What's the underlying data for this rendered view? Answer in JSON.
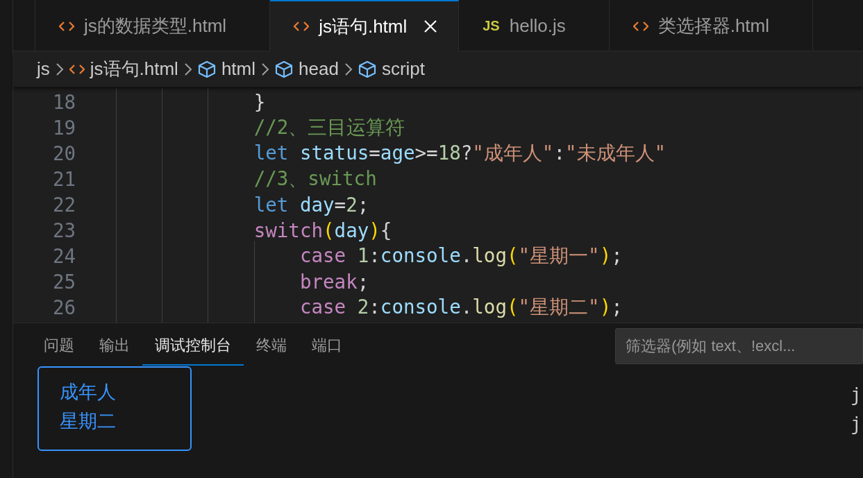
{
  "tabs": [
    {
      "label": "js的数据类型.html",
      "kind": "html",
      "selected": false
    },
    {
      "label": "js语句.html",
      "kind": "html",
      "selected": true
    },
    {
      "label": "hello.js",
      "kind": "js",
      "badge": "JS",
      "selected": false
    },
    {
      "label": "类选择器.html",
      "kind": "html",
      "selected": false
    }
  ],
  "breadcrumbs": [
    {
      "label": "js",
      "kind": "folder"
    },
    {
      "label": "js语句.html",
      "kind": "html"
    },
    {
      "label": "html",
      "kind": "element"
    },
    {
      "label": "head",
      "kind": "element"
    },
    {
      "label": "script",
      "kind": "element"
    }
  ],
  "editor": {
    "lines": [
      {
        "number": "18",
        "tokens": [
          {
            "kind": "punc",
            "text": "            }"
          }
        ]
      },
      {
        "number": "19",
        "tokens": [
          {
            "kind": "comment",
            "text": "            //2、三目运算符"
          }
        ]
      },
      {
        "number": "20",
        "tokens": [
          {
            "kind": "keyword",
            "text": "            let"
          },
          {
            "kind": "var",
            "text": " status"
          },
          {
            "kind": "punc",
            "text": "="
          },
          {
            "kind": "var",
            "text": "age"
          },
          {
            "kind": "punc",
            "text": ">="
          },
          {
            "kind": "number",
            "text": "18"
          },
          {
            "kind": "punc",
            "text": "?"
          },
          {
            "kind": "string",
            "text": "\"成年人\""
          },
          {
            "kind": "punc",
            "text": ":"
          },
          {
            "kind": "string",
            "text": "\"未成年人\""
          }
        ]
      },
      {
        "number": "21",
        "tokens": [
          {
            "kind": "comment",
            "text": "            //3、switch"
          }
        ]
      },
      {
        "number": "22",
        "tokens": [
          {
            "kind": "keyword",
            "text": "            let"
          },
          {
            "kind": "var",
            "text": " day"
          },
          {
            "kind": "punc",
            "text": "="
          },
          {
            "kind": "number",
            "text": "2"
          },
          {
            "kind": "punc",
            "text": ";"
          }
        ]
      },
      {
        "number": "23",
        "tokens": [
          {
            "kind": "control",
            "text": "            switch"
          },
          {
            "kind": "bracket",
            "text": "("
          },
          {
            "kind": "var",
            "text": "day"
          },
          {
            "kind": "bracket",
            "text": ")"
          },
          {
            "kind": "punc",
            "text": "{"
          }
        ]
      },
      {
        "number": "24",
        "tokens": [
          {
            "kind": "control",
            "text": "                case"
          },
          {
            "kind": "number",
            "text": " 1"
          },
          {
            "kind": "punc",
            "text": ":"
          },
          {
            "kind": "var",
            "text": "console"
          },
          {
            "kind": "punc",
            "text": "."
          },
          {
            "kind": "function",
            "text": "log"
          },
          {
            "kind": "bracket",
            "text": "("
          },
          {
            "kind": "string",
            "text": "\"星期一\""
          },
          {
            "kind": "bracket",
            "text": ")"
          },
          {
            "kind": "punc",
            "text": ";"
          }
        ]
      },
      {
        "number": "25",
        "tokens": [
          {
            "kind": "control",
            "text": "                break"
          },
          {
            "kind": "punc",
            "text": ";"
          }
        ]
      },
      {
        "number": "26",
        "tokens": [
          {
            "kind": "control",
            "text": "                case"
          },
          {
            "kind": "number",
            "text": " 2"
          },
          {
            "kind": "punc",
            "text": ":"
          },
          {
            "kind": "var",
            "text": "console"
          },
          {
            "kind": "punc",
            "text": "."
          },
          {
            "kind": "function",
            "text": "log"
          },
          {
            "kind": "bracket",
            "text": "("
          },
          {
            "kind": "string",
            "text": "\"星期二\""
          },
          {
            "kind": "bracket",
            "text": ")"
          },
          {
            "kind": "punc",
            "text": ";"
          }
        ]
      }
    ]
  },
  "panel": {
    "tabs": [
      {
        "label": "问题",
        "selected": false
      },
      {
        "label": "输出",
        "selected": false
      },
      {
        "label": "调试控制台",
        "selected": true
      },
      {
        "label": "终端",
        "selected": false
      },
      {
        "label": "端口",
        "selected": false
      }
    ],
    "filter": {
      "placeholder": "筛选器(例如 text、!excl..."
    },
    "console": {
      "messages": [
        "成年人",
        "星期二"
      ],
      "sources": [
        "j",
        "j"
      ]
    }
  }
}
